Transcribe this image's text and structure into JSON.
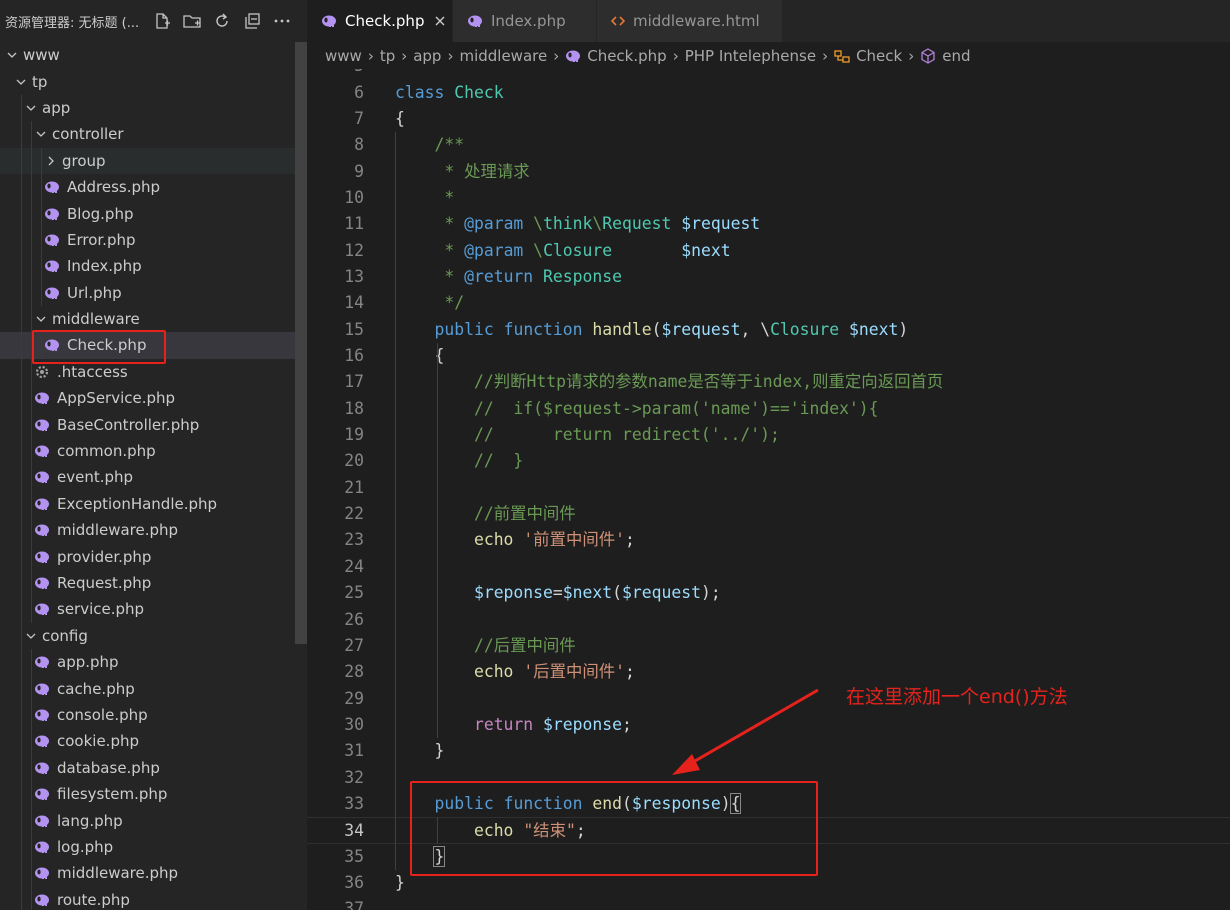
{
  "sidebar": {
    "title": "资源管理器: 无标题 (...",
    "actions": [
      "new-file-icon",
      "new-folder-icon",
      "refresh-icon",
      "collapse-all-icon",
      "more-icon"
    ],
    "tree": [
      {
        "label": "www",
        "type": "folder",
        "expanded": true,
        "depth": 0
      },
      {
        "label": "tp",
        "type": "folder",
        "expanded": true,
        "depth": 1
      },
      {
        "label": "app",
        "type": "folder",
        "expanded": true,
        "depth": 2
      },
      {
        "label": "controller",
        "type": "folder",
        "expanded": true,
        "depth": 3
      },
      {
        "label": "group",
        "type": "folder",
        "expanded": false,
        "depth": 4
      },
      {
        "label": "Address.php",
        "type": "php",
        "depth": 4
      },
      {
        "label": "Blog.php",
        "type": "php",
        "depth": 4
      },
      {
        "label": "Error.php",
        "type": "php",
        "depth": 4
      },
      {
        "label": "Index.php",
        "type": "php",
        "depth": 4
      },
      {
        "label": "Url.php",
        "type": "php",
        "depth": 4
      },
      {
        "label": "middleware",
        "type": "folder",
        "expanded": true,
        "depth": 3
      },
      {
        "label": "Check.php",
        "type": "php",
        "depth": 4,
        "selected": true
      },
      {
        "label": ".htaccess",
        "type": "gear",
        "depth": 3
      },
      {
        "label": "AppService.php",
        "type": "php",
        "depth": 3
      },
      {
        "label": "BaseController.php",
        "type": "php",
        "depth": 3
      },
      {
        "label": "common.php",
        "type": "php",
        "depth": 3
      },
      {
        "label": "event.php",
        "type": "php",
        "depth": 3
      },
      {
        "label": "ExceptionHandle.php",
        "type": "php",
        "depth": 3
      },
      {
        "label": "middleware.php",
        "type": "php",
        "depth": 3
      },
      {
        "label": "provider.php",
        "type": "php",
        "depth": 3
      },
      {
        "label": "Request.php",
        "type": "php",
        "depth": 3
      },
      {
        "label": "service.php",
        "type": "php",
        "depth": 3
      },
      {
        "label": "config",
        "type": "folder",
        "expanded": true,
        "depth": 2
      },
      {
        "label": "app.php",
        "type": "php",
        "depth": 3
      },
      {
        "label": "cache.php",
        "type": "php",
        "depth": 3
      },
      {
        "label": "console.php",
        "type": "php",
        "depth": 3
      },
      {
        "label": "cookie.php",
        "type": "php",
        "depth": 3
      },
      {
        "label": "database.php",
        "type": "php",
        "depth": 3
      },
      {
        "label": "filesystem.php",
        "type": "php",
        "depth": 3
      },
      {
        "label": "lang.php",
        "type": "php",
        "depth": 3
      },
      {
        "label": "log.php",
        "type": "php",
        "depth": 3
      },
      {
        "label": "middleware.php",
        "type": "php",
        "depth": 3
      },
      {
        "label": "route.php",
        "type": "php",
        "depth": 3
      }
    ]
  },
  "tabs": [
    {
      "label": "Check.php",
      "icon": "php-elephant-icon",
      "active": true
    },
    {
      "label": "Index.php",
      "icon": "php-elephant-icon",
      "active": false
    },
    {
      "label": "middleware.html",
      "icon": "html-brackets-icon",
      "active": false
    }
  ],
  "breadcrumb": [
    "www",
    "tp",
    "app",
    "middleware",
    "Check.php",
    "PHP Intelephense",
    "Check",
    "end"
  ],
  "code": {
    "first_line_partial": "5",
    "lines": [
      {
        "n": "6",
        "tokens": [
          [
            "kw",
            "class"
          ],
          [
            "pl",
            " "
          ],
          [
            "cls",
            "Check"
          ]
        ]
      },
      {
        "n": "7",
        "tokens": [
          [
            "pl",
            "{"
          ]
        ]
      },
      {
        "n": "8",
        "tokens": [
          [
            "pl",
            "    "
          ],
          [
            "cm",
            "/**"
          ]
        ]
      },
      {
        "n": "9",
        "tokens": [
          [
            "pl",
            "     "
          ],
          [
            "cm",
            "* 处理请求"
          ]
        ]
      },
      {
        "n": "10",
        "tokens": [
          [
            "pl",
            "     "
          ],
          [
            "cm",
            "*"
          ]
        ]
      },
      {
        "n": "11",
        "tokens": [
          [
            "pl",
            "     "
          ],
          [
            "cm",
            "* "
          ],
          [
            "ann",
            "@param"
          ],
          [
            "cm",
            " \\"
          ],
          [
            "cls",
            "think"
          ],
          [
            "cm",
            "\\"
          ],
          [
            "cls",
            "Request"
          ],
          [
            "cm",
            " "
          ],
          [
            "var",
            "$request"
          ]
        ]
      },
      {
        "n": "12",
        "tokens": [
          [
            "pl",
            "     "
          ],
          [
            "cm",
            "* "
          ],
          [
            "ann",
            "@param"
          ],
          [
            "cm",
            " \\"
          ],
          [
            "cls",
            "Closure"
          ],
          [
            "cm",
            "       "
          ],
          [
            "var",
            "$next"
          ]
        ]
      },
      {
        "n": "13",
        "tokens": [
          [
            "pl",
            "     "
          ],
          [
            "cm",
            "* "
          ],
          [
            "ann",
            "@return"
          ],
          [
            "cm",
            " "
          ],
          [
            "cls",
            "Response"
          ]
        ]
      },
      {
        "n": "14",
        "tokens": [
          [
            "pl",
            "     "
          ],
          [
            "cm",
            "*/"
          ]
        ]
      },
      {
        "n": "15",
        "tokens": [
          [
            "pl",
            "    "
          ],
          [
            "kw",
            "public"
          ],
          [
            "pl",
            " "
          ],
          [
            "kw",
            "function"
          ],
          [
            "pl",
            " "
          ],
          [
            "fn",
            "handle"
          ],
          [
            "pl",
            "("
          ],
          [
            "var",
            "$request"
          ],
          [
            "pl",
            ", \\"
          ],
          [
            "cls",
            "Closure"
          ],
          [
            "pl",
            " "
          ],
          [
            "var",
            "$next"
          ],
          [
            "pl",
            ")"
          ]
        ]
      },
      {
        "n": "16",
        "tokens": [
          [
            "pl",
            "    {"
          ]
        ]
      },
      {
        "n": "17",
        "tokens": [
          [
            "pl",
            "        "
          ],
          [
            "cm",
            "//判断Http请求的参数name是否等于index,则重定向返回首页"
          ]
        ]
      },
      {
        "n": "18",
        "tokens": [
          [
            "pl",
            "        "
          ],
          [
            "cm",
            "//  if($request->param('name')=='index'){"
          ]
        ]
      },
      {
        "n": "19",
        "tokens": [
          [
            "pl",
            "        "
          ],
          [
            "cm",
            "//      return redirect('../');"
          ]
        ]
      },
      {
        "n": "20",
        "tokens": [
          [
            "pl",
            "        "
          ],
          [
            "cm",
            "//  }"
          ]
        ]
      },
      {
        "n": "21",
        "tokens": []
      },
      {
        "n": "22",
        "tokens": [
          [
            "pl",
            "        "
          ],
          [
            "cm",
            "//前置中间件"
          ]
        ]
      },
      {
        "n": "23",
        "tokens": [
          [
            "pl",
            "        "
          ],
          [
            "fn",
            "echo"
          ],
          [
            "pl",
            " "
          ],
          [
            "str",
            "'前置中间件'"
          ],
          [
            "pl",
            ";"
          ]
        ]
      },
      {
        "n": "24",
        "tokens": []
      },
      {
        "n": "25",
        "tokens": [
          [
            "pl",
            "        "
          ],
          [
            "var",
            "$reponse"
          ],
          [
            "pl",
            "="
          ],
          [
            "var",
            "$next"
          ],
          [
            "pl",
            "("
          ],
          [
            "var",
            "$request"
          ],
          [
            "pl",
            ");"
          ]
        ]
      },
      {
        "n": "26",
        "tokens": []
      },
      {
        "n": "27",
        "tokens": [
          [
            "pl",
            "        "
          ],
          [
            "cm",
            "//后置中间件"
          ]
        ]
      },
      {
        "n": "28",
        "tokens": [
          [
            "pl",
            "        "
          ],
          [
            "fn",
            "echo"
          ],
          [
            "pl",
            " "
          ],
          [
            "str",
            "'后置中间件'"
          ],
          [
            "pl",
            ";"
          ]
        ]
      },
      {
        "n": "29",
        "tokens": []
      },
      {
        "n": "30",
        "tokens": [
          [
            "pl",
            "        "
          ],
          [
            "ctl",
            "return"
          ],
          [
            "pl",
            " "
          ],
          [
            "var",
            "$reponse"
          ],
          [
            "pl",
            ";"
          ]
        ]
      },
      {
        "n": "31",
        "tokens": [
          [
            "pl",
            "    }"
          ]
        ]
      },
      {
        "n": "32",
        "tokens": []
      },
      {
        "n": "33",
        "tokens": [
          [
            "pl",
            "    "
          ],
          [
            "kw",
            "public"
          ],
          [
            "pl",
            " "
          ],
          [
            "kw",
            "function"
          ],
          [
            "pl",
            " "
          ],
          [
            "fn",
            "end"
          ],
          [
            "pl",
            "("
          ],
          [
            "var",
            "$response"
          ],
          [
            "pl",
            ")"
          ],
          [
            "pl",
            "{"
          ]
        ]
      },
      {
        "n": "34",
        "tokens": [
          [
            "pl",
            "        "
          ],
          [
            "fn",
            "echo"
          ],
          [
            "pl",
            " "
          ],
          [
            "str",
            "\"结束\""
          ],
          [
            "pl",
            ";"
          ]
        ],
        "current": true
      },
      {
        "n": "35",
        "tokens": [
          [
            "pl",
            "    "
          ],
          [
            "pl",
            "}"
          ]
        ]
      },
      {
        "n": "36",
        "tokens": [
          [
            "pl",
            "}"
          ]
        ]
      },
      {
        "n": "37",
        "tokens": []
      }
    ]
  },
  "annotation": {
    "text": "在这里添加一个end()方法",
    "color": "#e5221c"
  },
  "colors": {
    "highlight_box": "#e5221c",
    "php_icon": "#b392f0",
    "html_icon": "#e37933"
  }
}
